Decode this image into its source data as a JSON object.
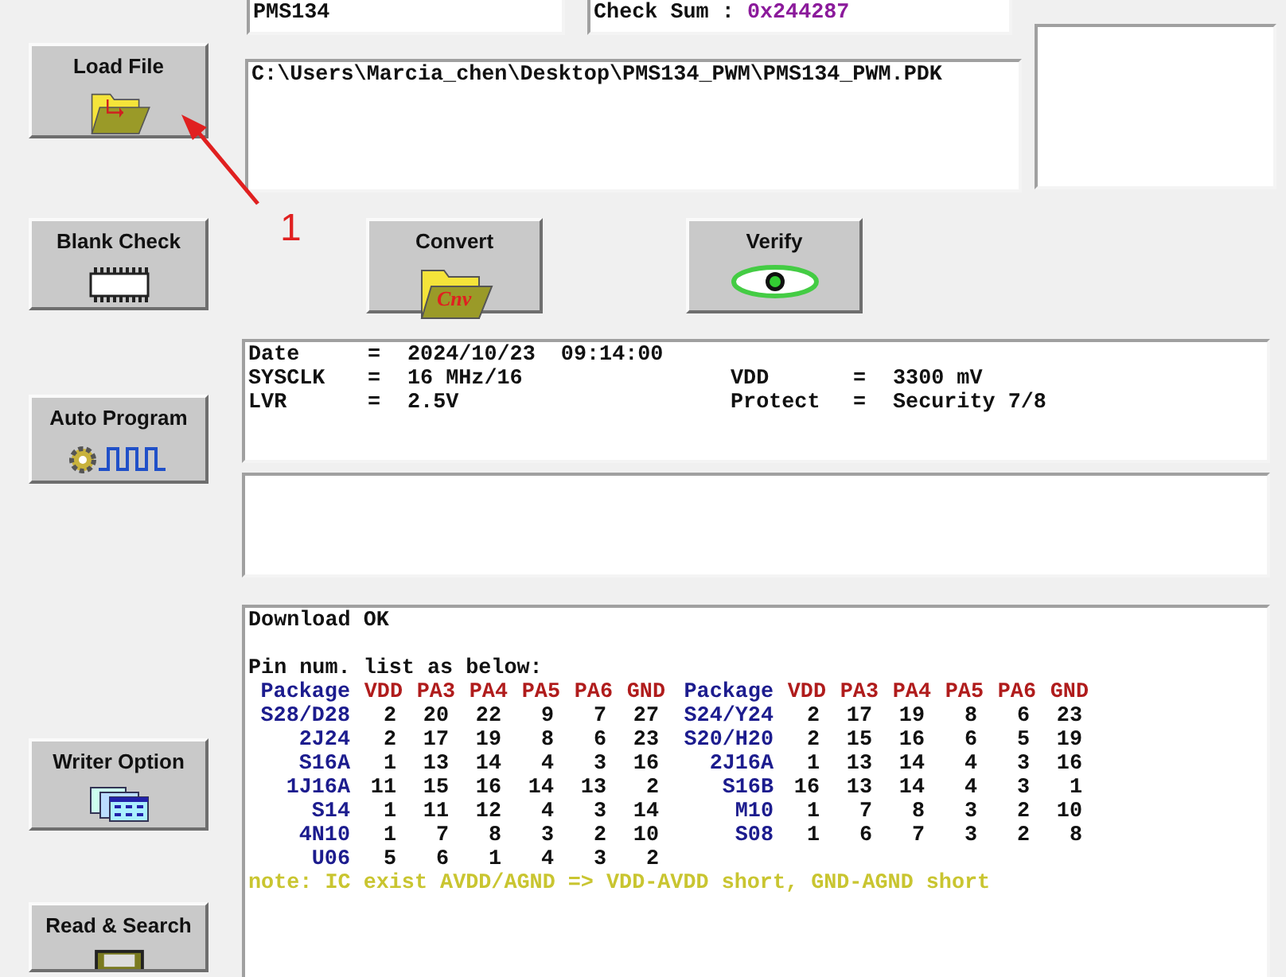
{
  "header": {
    "device": "PMS134",
    "checksum_label": "Check Sum :",
    "checksum_value": "0x244287"
  },
  "file_path": "C:\\Users\\Marcia_chen\\Desktop\\PMS134_PWM\\PMS134_PWM.PDK",
  "side_buttons": [
    {
      "label": "Load File",
      "kind": "load"
    },
    {
      "label": "Blank Check",
      "kind": "blank"
    },
    {
      "label": "Auto Program",
      "kind": "auto"
    },
    {
      "label": "Writer Option",
      "kind": "option"
    },
    {
      "label": "Read & Search",
      "kind": "read"
    }
  ],
  "action_buttons": [
    {
      "label": "Convert",
      "kind": "convert",
      "icon_text": "Cnv"
    },
    {
      "label": "Verify",
      "kind": "verify"
    }
  ],
  "annotation": {
    "number": "1"
  },
  "info": {
    "rows": [
      {
        "key": "Date",
        "sep": "=",
        "value": "2024/10/23  09:14:00"
      },
      {
        "key": "SYSCLK",
        "sep": "=",
        "value": "16 MHz/16",
        "key2": "VDD",
        "sep2": "=",
        "value2": "3300 mV"
      },
      {
        "key": "LVR",
        "sep": "=",
        "value": "2.5V",
        "key2": "Protect",
        "sep2": "=",
        "value2": "Security 7/8"
      }
    ]
  },
  "log": {
    "status": "Download OK",
    "intro": "Pin num. list as below:",
    "pin_table": {
      "columns": [
        "Package",
        "VDD",
        "PA3",
        "PA4",
        "PA5",
        "PA6",
        "GND",
        "Package",
        "VDD",
        "PA3",
        "PA4",
        "PA5",
        "PA6",
        "GND"
      ],
      "rows": [
        [
          "S28/D28",
          "2",
          "20",
          "22",
          "9",
          "7",
          "27",
          "S24/Y24",
          "2",
          "17",
          "19",
          "8",
          "6",
          "23"
        ],
        [
          "2J24",
          "2",
          "17",
          "19",
          "8",
          "6",
          "23",
          "S20/H20",
          "2",
          "15",
          "16",
          "6",
          "5",
          "19"
        ],
        [
          "S16A",
          "1",
          "13",
          "14",
          "4",
          "3",
          "16",
          "2J16A",
          "1",
          "13",
          "14",
          "4",
          "3",
          "16"
        ],
        [
          "1J16A",
          "11",
          "15",
          "16",
          "14",
          "13",
          "2",
          "S16B",
          "16",
          "13",
          "14",
          "4",
          "3",
          "1"
        ],
        [
          "S14",
          "1",
          "11",
          "12",
          "4",
          "3",
          "14",
          "M10",
          "1",
          "7",
          "8",
          "3",
          "2",
          "10"
        ],
        [
          "4N10",
          "1",
          "7",
          "8",
          "3",
          "2",
          "10",
          "S08",
          "1",
          "6",
          "7",
          "3",
          "2",
          "8"
        ],
        [
          "U06",
          "5",
          "6",
          "1",
          "4",
          "3",
          "2"
        ]
      ]
    },
    "note": "note: IC exist AVDD/AGND => VDD-AVDD short, GND-AGND short"
  }
}
